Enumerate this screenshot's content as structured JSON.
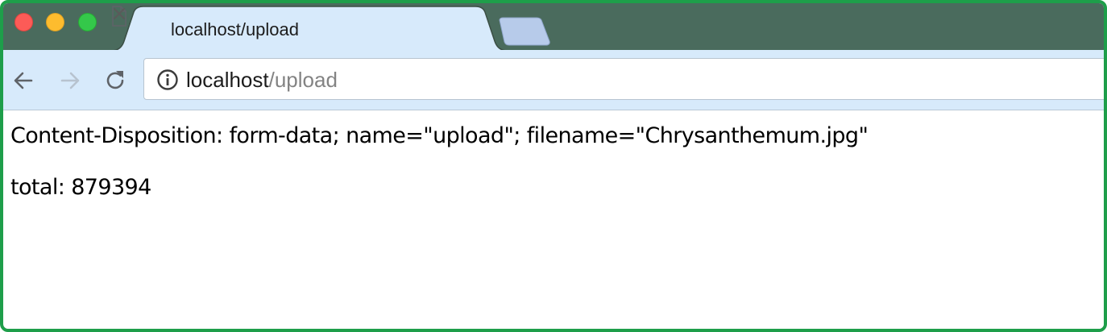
{
  "browser": {
    "tabs": [
      {
        "title": "localhost/upload",
        "close_label": "×"
      }
    ],
    "address_bar": {
      "host": "localhost",
      "path": "/upload"
    },
    "icons": {
      "back": "back-arrow-icon",
      "forward": "forward-arrow-icon",
      "reload": "reload-icon",
      "site_info": "info-icon",
      "page": "page-icon"
    },
    "colors": {
      "tabstrip": "#4a6b5d",
      "toolbar": "#d7eafb",
      "frame_border": "#1e9e4a",
      "traffic_close": "#fc5b57",
      "traffic_minimize": "#fdbc2e",
      "traffic_maximize": "#34c84a"
    }
  },
  "page": {
    "lines": [
      "Content-Disposition: form-data; name=\"upload\"; filename=\"Chrysanthemum.jpg\"",
      "total: 879394"
    ]
  }
}
